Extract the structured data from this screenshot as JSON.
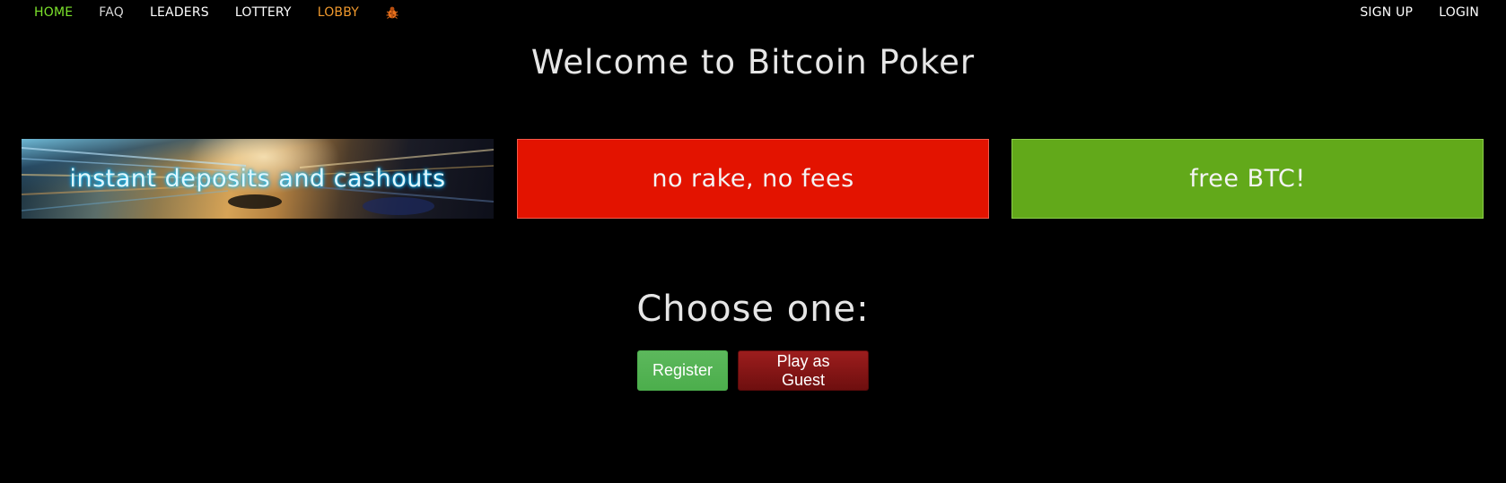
{
  "nav": {
    "left": [
      {
        "label": "HOME",
        "color": "#7be12b"
      },
      {
        "label": "FAQ",
        "color": "#d6d6d6"
      },
      {
        "label": "LEADERS",
        "color": "#ffffff"
      },
      {
        "label": "LOTTERY",
        "color": "#ffffff"
      },
      {
        "label": "LOBBY",
        "color": "#f0992d"
      }
    ],
    "bug_icon": "bug-icon",
    "right": [
      {
        "label": "SIGN UP"
      },
      {
        "label": "LOGIN"
      }
    ]
  },
  "title": "Welcome to Bitcoin Poker",
  "banners": [
    {
      "label": "instant deposits and cashouts"
    },
    {
      "label": "no rake, no fees",
      "color": "#e31300"
    },
    {
      "label": "free BTC!",
      "color": "#62a91a"
    }
  ],
  "choose": {
    "heading": "Choose one:",
    "register_label": "Register",
    "guest_label": "Play as Guest"
  }
}
